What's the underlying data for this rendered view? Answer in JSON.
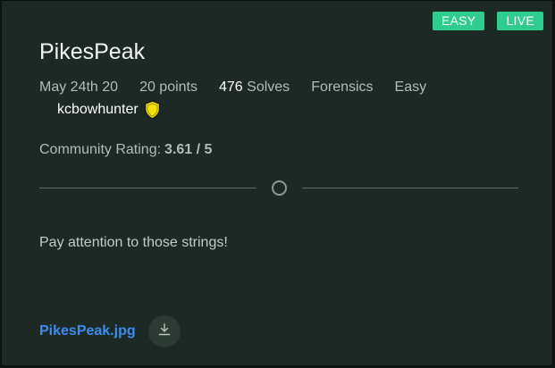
{
  "badges": {
    "difficulty": "EASY",
    "status": "LIVE"
  },
  "challenge": {
    "title": "PikesPeak",
    "date": "May 24th 20",
    "points": "20 points",
    "solves_count": "476",
    "solves_label": "Solves",
    "category": "Forensics",
    "difficulty": "Easy",
    "author": "kcbowhunter",
    "author_icon": "shield-icon"
  },
  "rating": {
    "label": "Community Rating:",
    "value": "3.61 / 5"
  },
  "description": "Pay attention to those strings!",
  "attachment": {
    "filename": "PikesPeak.jpg",
    "download_icon": "download-icon"
  },
  "colors": {
    "background": "#1c2924",
    "badge": "#2ecc8f",
    "link": "#3d8cf0",
    "shield": "#f5e10a"
  }
}
